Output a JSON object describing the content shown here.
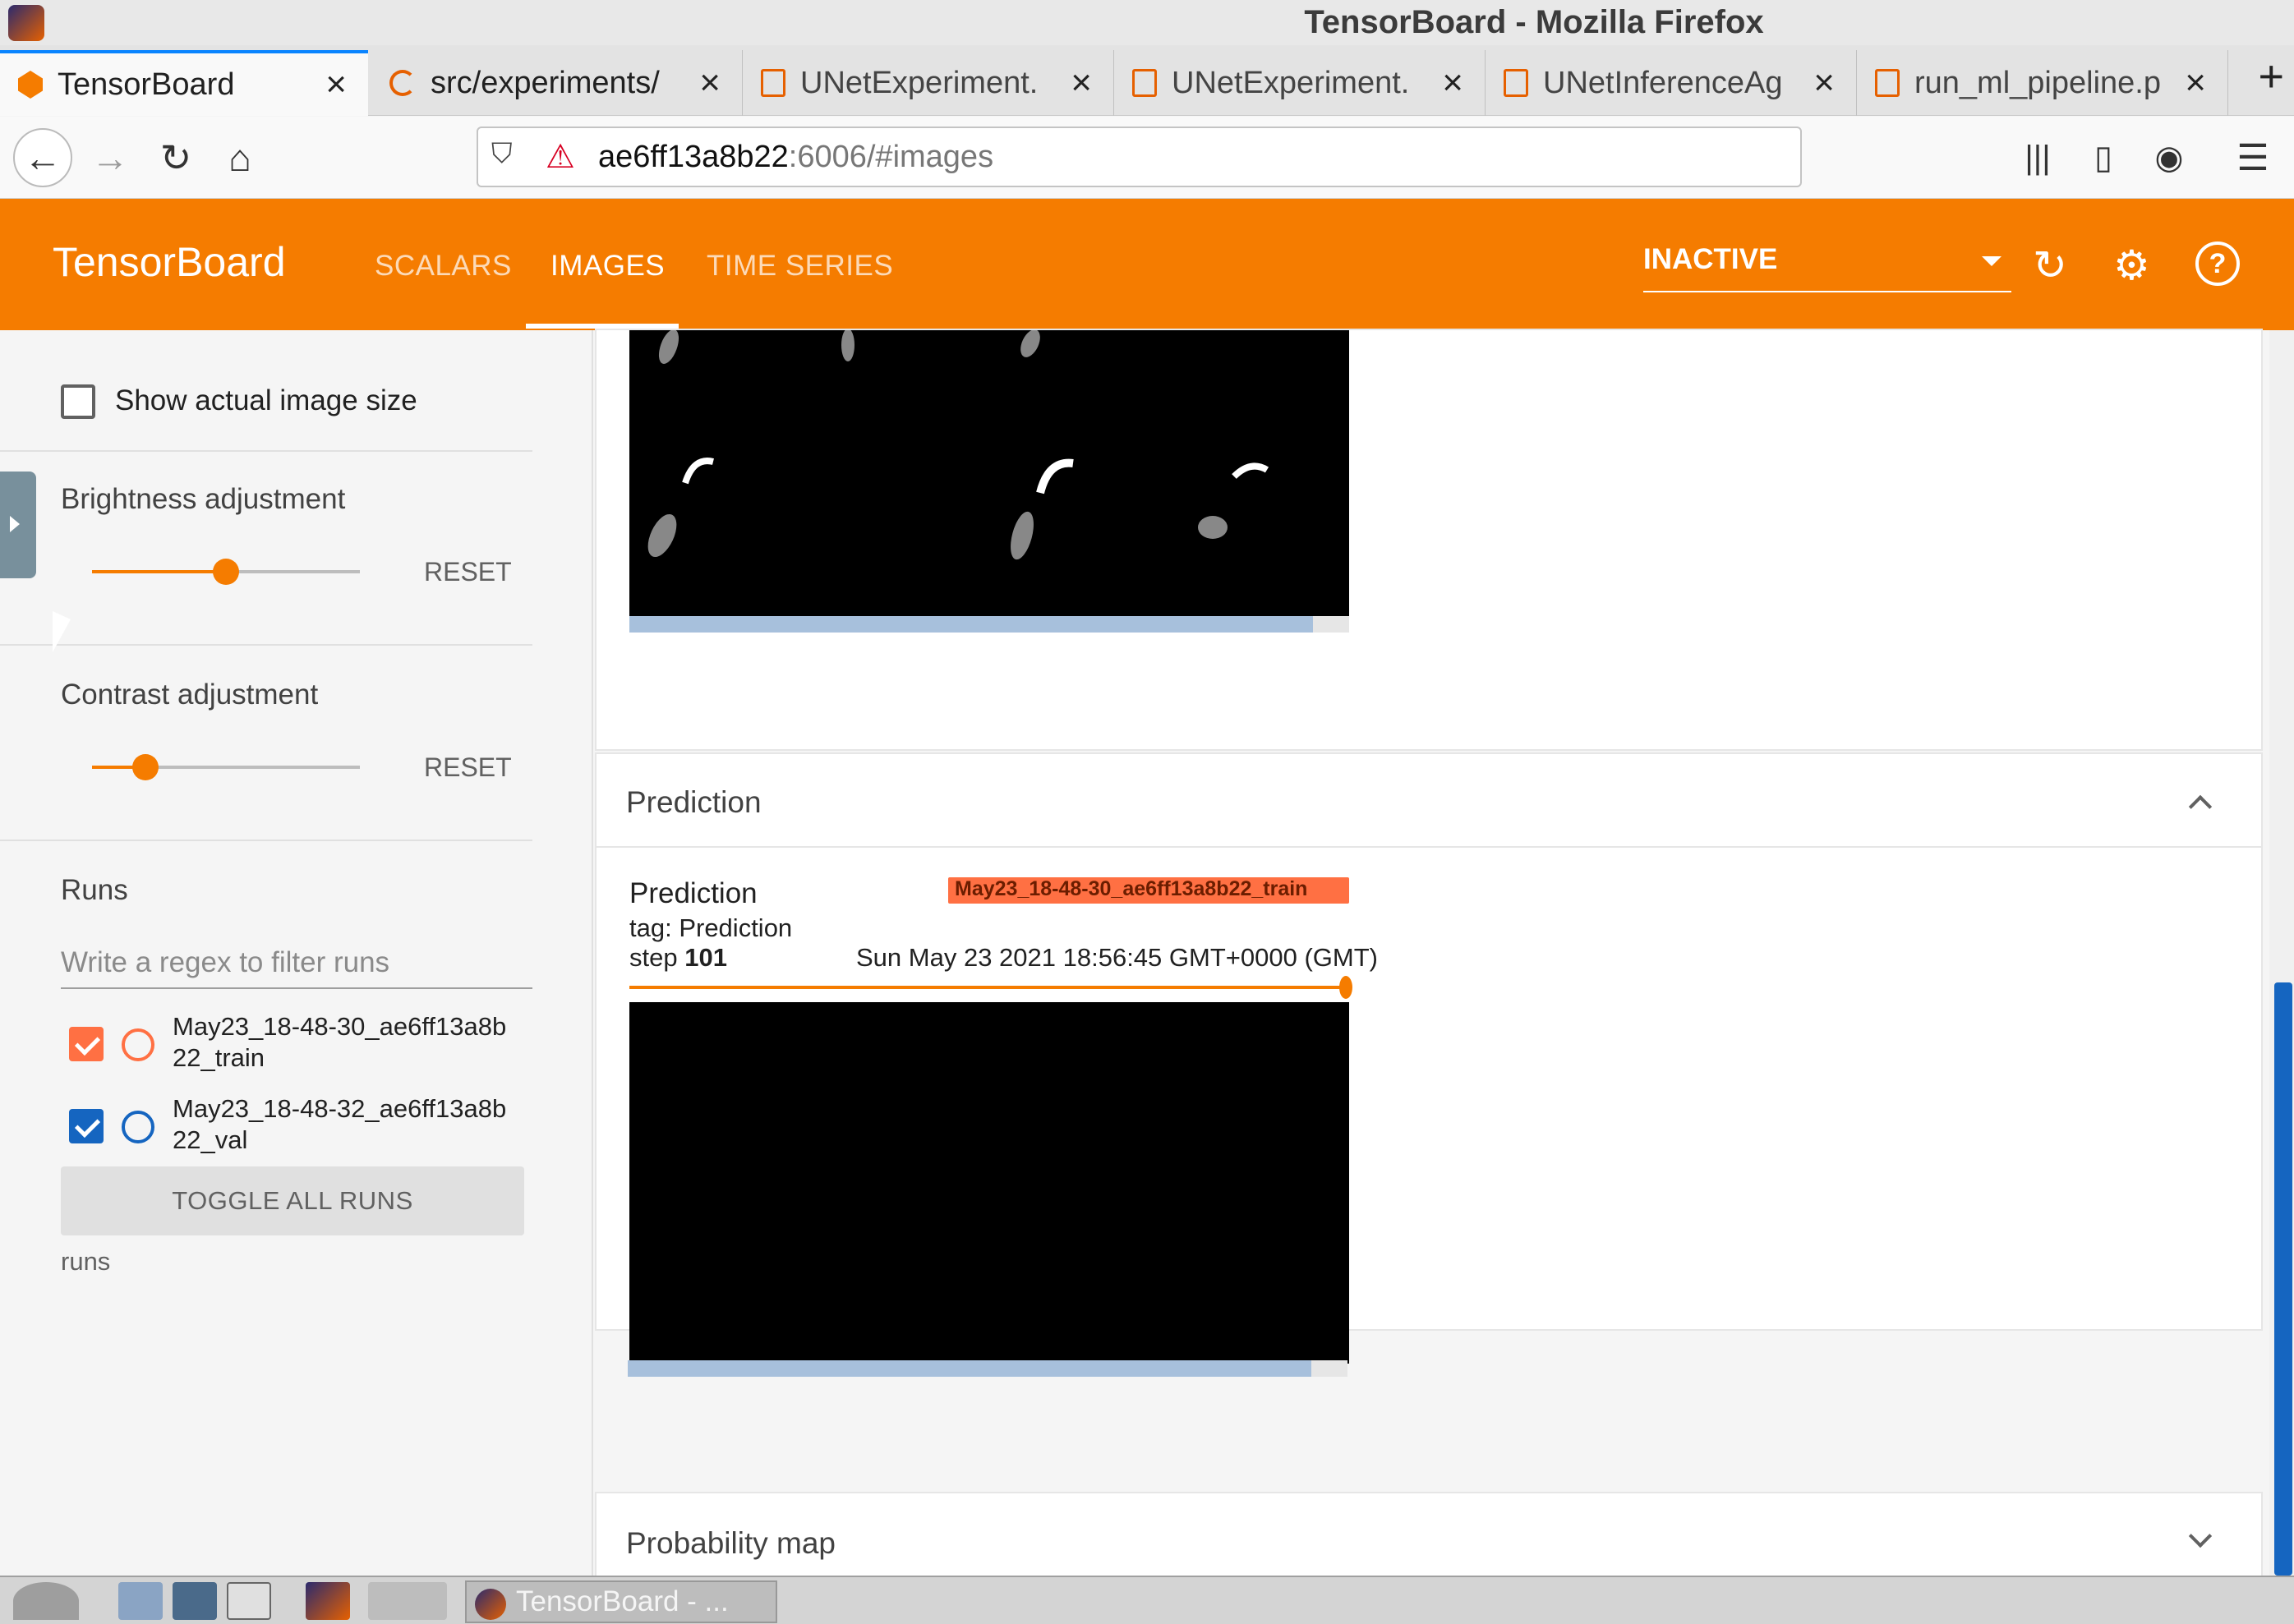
{
  "window": {
    "title": "TensorBoard - Mozilla Firefox"
  },
  "browser": {
    "tabs": [
      {
        "label": "TensorBoard",
        "icon": "tensorboard-icon",
        "active": true
      },
      {
        "label": "src/experiments/",
        "icon": "loading-spinner-icon",
        "active": false
      },
      {
        "label": "UNetExperiment.",
        "icon": "document-icon",
        "active": false
      },
      {
        "label": "UNetExperiment.",
        "icon": "document-icon",
        "active": false
      },
      {
        "label": "UNetInferenceAg",
        "icon": "document-icon",
        "active": false
      },
      {
        "label": "run_ml_pipeline.p",
        "icon": "document-icon",
        "active": false
      }
    ],
    "url": {
      "host": "ae6ff13a8b22",
      "rest": ":6006/#images"
    }
  },
  "tensorboard": {
    "brand": "TensorBoard",
    "nav_tabs": [
      {
        "label": "SCALARS",
        "active": false
      },
      {
        "label": "IMAGES",
        "active": true
      },
      {
        "label": "TIME SERIES",
        "active": false
      }
    ],
    "status_select": "INACTIVE"
  },
  "sidebar": {
    "show_actual_size_label": "Show actual image size",
    "show_actual_size_checked": false,
    "brightness": {
      "label": "Brightness adjustment",
      "value_fraction": 0.5,
      "reset_label": "RESET"
    },
    "contrast": {
      "label": "Contrast adjustment",
      "value_fraction": 0.2,
      "reset_label": "RESET"
    },
    "runs": {
      "title": "Runs",
      "filter_placeholder": "Write a regex to filter runs",
      "items": [
        {
          "name_line1": "May23_18-48-30_ae6ff13a8b",
          "name_line2": "22_train",
          "checked": true,
          "color": "#ff7043"
        },
        {
          "name_line1": "May23_18-48-32_ae6ff13a8b",
          "name_line2": "22_val",
          "checked": true,
          "color": "#1565c0"
        }
      ],
      "toggle_all_label": "TOGGLE ALL RUNS",
      "footer_label": "runs"
    }
  },
  "main": {
    "prediction_section": {
      "title": "Prediction",
      "card": {
        "name": "Prediction",
        "tag_line": "tag: Prediction",
        "step_prefix": "step",
        "step_value": "101",
        "timestamp": "Sun May 23 2021 18:56:45 GMT+0000 (GMT)",
        "run_chip": "May23_18-48-30_ae6ff13a8b22_train",
        "step_slider_fraction": 1.0,
        "image_loaded_fraction": 0.95
      }
    },
    "probability_section": {
      "title": "Probability map"
    },
    "previous_card": {
      "image_loaded_fraction": 0.95
    }
  },
  "taskbar": {
    "active_window": "TensorBoard - ..."
  },
  "colors": {
    "accent": "#f57c00",
    "train_run": "#ff7043",
    "val_run": "#1565c0"
  }
}
